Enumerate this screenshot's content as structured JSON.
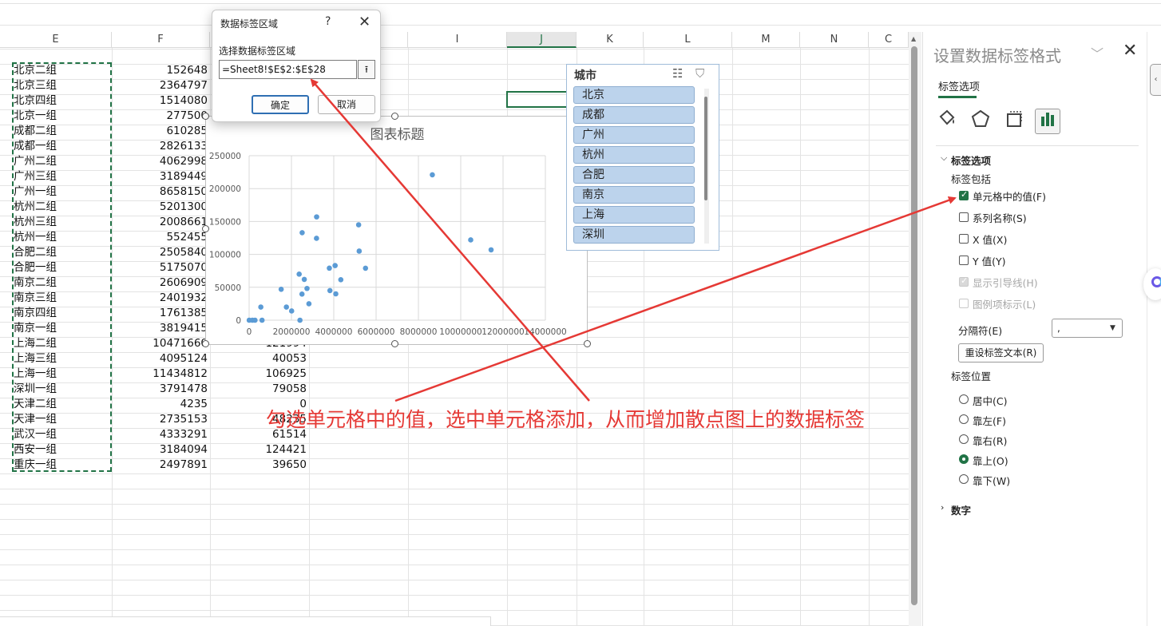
{
  "sheet": {
    "columns": [
      {
        "id": "E",
        "label": "E"
      },
      {
        "id": "F",
        "label": "F"
      },
      {
        "id": "G",
        "label": ""
      },
      {
        "id": "H",
        "label": ""
      },
      {
        "id": "I",
        "label": "I"
      },
      {
        "id": "J",
        "label": "J"
      },
      {
        "id": "K",
        "label": "K"
      },
      {
        "id": "L",
        "label": "L"
      },
      {
        "id": "M",
        "label": "M"
      },
      {
        "id": "N",
        "label": "N"
      },
      {
        "id": "O",
        "label": "C"
      }
    ],
    "rows": [
      {
        "group": "北京二组",
        "f": "152648",
        "g": ""
      },
      {
        "group": "北京三组",
        "f": "2364797",
        "g": ""
      },
      {
        "group": "北京四组",
        "f": "1514080",
        "g": ""
      },
      {
        "group": "北京一组",
        "f": "277500",
        "g": ""
      },
      {
        "group": "成都二组",
        "f": "610285",
        "g": ""
      },
      {
        "group": "成都一组",
        "f": "2826133",
        "g": ""
      },
      {
        "group": "广州二组",
        "f": "4062998",
        "g": ""
      },
      {
        "group": "广州三组",
        "f": "3189449",
        "g": ""
      },
      {
        "group": "广州一组",
        "f": "8658150",
        "g": ""
      },
      {
        "group": "杭州二组",
        "f": "5201300",
        "g": ""
      },
      {
        "group": "杭州三组",
        "f": "2008661",
        "g": ""
      },
      {
        "group": "杭州一组",
        "f": "552455",
        "g": ""
      },
      {
        "group": "合肥二组",
        "f": "2505840",
        "g": ""
      },
      {
        "group": "合肥一组",
        "f": "5175070",
        "g": ""
      },
      {
        "group": "南京二组",
        "f": "2606909",
        "g": ""
      },
      {
        "group": "南京三组",
        "f": "2401932",
        "g": ""
      },
      {
        "group": "南京四组",
        "f": "1761385",
        "g": ""
      },
      {
        "group": "南京一组",
        "f": "3819415",
        "g": ""
      },
      {
        "group": "上海二组",
        "f": "10471660",
        "g": "121994"
      },
      {
        "group": "上海三组",
        "f": "4095124",
        "g": "40053"
      },
      {
        "group": "上海一组",
        "f": "11434812",
        "g": "106925"
      },
      {
        "group": "深圳一组",
        "f": "3791478",
        "g": "79058"
      },
      {
        "group": "天津二组",
        "f": "4235",
        "g": "0"
      },
      {
        "group": "天津一组",
        "f": "2735153",
        "g": "48235"
      },
      {
        "group": "武汉一组",
        "f": "4333291",
        "g": "61514"
      },
      {
        "group": "西安一组",
        "f": "3184094",
        "g": "124421"
      },
      {
        "group": "重庆一组",
        "f": "2497891",
        "g": "39650"
      }
    ]
  },
  "dialog": {
    "title": "数据标签区域",
    "help": "?",
    "close": "✕",
    "label": "选择数据标签区域",
    "range_value": "=Sheet8!$E$2:$E$28",
    "collapse": "⭱",
    "ok": "确定",
    "cancel": "取消"
  },
  "chart_data": {
    "type": "scatter",
    "title": "图表标题",
    "xlabel": "",
    "ylabel": "",
    "xlim": [
      0,
      14000000
    ],
    "ylim": [
      0,
      250000
    ],
    "x_ticks": [
      "0",
      "2000000",
      "4000000",
      "6000000",
      "8000000",
      "10000000",
      "12000000",
      "14000000"
    ],
    "y_ticks": [
      "0",
      "50000",
      "100000",
      "150000",
      "200000",
      "250000"
    ],
    "grid": true,
    "color": "#5b9bd5",
    "points": [
      [
        152648,
        0
      ],
      [
        277500,
        0
      ],
      [
        4235,
        0
      ],
      [
        610285,
        0
      ],
      [
        552455,
        20000
      ],
      [
        1514080,
        47000
      ],
      [
        1761385,
        20000
      ],
      [
        2008661,
        14000
      ],
      [
        2364797,
        70000
      ],
      [
        2401932,
        0
      ],
      [
        2497891,
        39650
      ],
      [
        2505840,
        133000
      ],
      [
        2606909,
        62000
      ],
      [
        2735153,
        48235
      ],
      [
        2826133,
        25000
      ],
      [
        3184094,
        124421
      ],
      [
        3189449,
        157000
      ],
      [
        3791478,
        79058
      ],
      [
        3819415,
        45000
      ],
      [
        4062998,
        83000
      ],
      [
        4095124,
        40053
      ],
      [
        4333291,
        61514
      ],
      [
        5175070,
        145000
      ],
      [
        5201300,
        105000
      ],
      [
        5500000,
        79000
      ],
      [
        8658150,
        221000
      ],
      [
        10471660,
        121994
      ],
      [
        11434812,
        106925
      ]
    ]
  },
  "slicer": {
    "title": "城市",
    "multi_select_icon": "multi-select-icon",
    "clear_filter_icon": "clear-filter-icon",
    "items": [
      "北京",
      "成都",
      "广州",
      "杭州",
      "合肥",
      "南京",
      "上海",
      "深圳"
    ]
  },
  "pane": {
    "title": "设置数据标签格式",
    "dropdown": "﹀",
    "close": "✕",
    "tab": "标签选项",
    "section_label_options": "标签选项",
    "label_contains": "标签包括",
    "options": [
      {
        "label": "单元格中的值(F)",
        "checked": true,
        "disabled": false
      },
      {
        "label": "系列名称(S)",
        "checked": false,
        "disabled": false
      },
      {
        "label": "X 值(X)",
        "checked": false,
        "disabled": false
      },
      {
        "label": "Y 值(Y)",
        "checked": false,
        "disabled": false
      },
      {
        "label": "显示引导线(H)",
        "checked": true,
        "disabled": true
      },
      {
        "label": "图例项标示(L)",
        "checked": false,
        "disabled": true
      }
    ],
    "separator_label": "分隔符(E)",
    "separator_value": ",",
    "reset_label": "重设标签文本(R)",
    "position_label": "标签位置",
    "positions": [
      {
        "label": "居中(C)",
        "selected": false
      },
      {
        "label": "靠左(F)",
        "selected": false
      },
      {
        "label": "靠右(R)",
        "selected": false
      },
      {
        "label": "靠上(O)",
        "selected": true
      },
      {
        "label": "靠下(W)",
        "selected": false
      }
    ],
    "section_number": "数字",
    "accent_color": "#217346"
  },
  "annotation": {
    "text": "勾选单元格中的值，选中单元格添加，从而增加散点图上的数据标签",
    "color": "#e53935"
  }
}
